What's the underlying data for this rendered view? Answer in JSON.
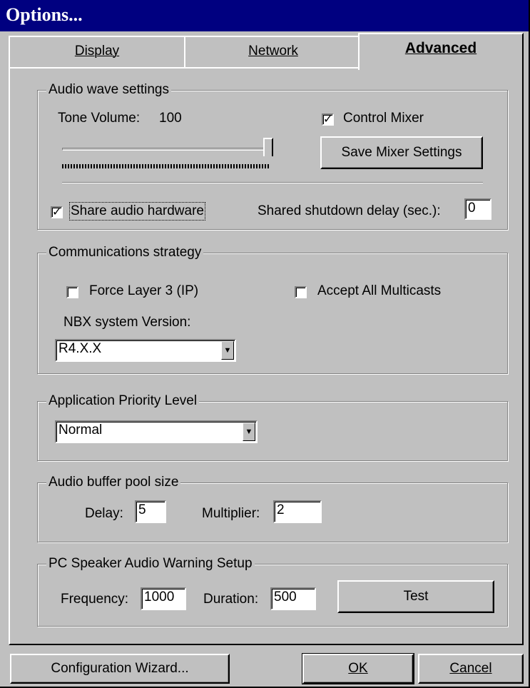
{
  "window": {
    "title": "Options..."
  },
  "tabs": [
    {
      "label": "Display",
      "active": false
    },
    {
      "label": "Network",
      "active": false
    },
    {
      "label": "Advanced",
      "active": true
    }
  ],
  "audio_wave": {
    "legend": "Audio wave settings",
    "tone_volume_label": "Tone Volume:",
    "tone_volume_value": "100",
    "tone_volume_fraction": 1.0,
    "control_mixer_label": "Control Mixer",
    "control_mixer_checked": true,
    "save_mixer_button": "Save Mixer Settings",
    "share_audio_label": "Share audio hardware",
    "share_audio_checked": true,
    "shutdown_delay_label": "Shared shutdown delay (sec.):",
    "shutdown_delay_value": "0"
  },
  "communications": {
    "legend": "Communications strategy",
    "force_layer3_label": "Force Layer 3 (IP)",
    "force_layer3_checked": false,
    "accept_multicasts_label": "Accept All Multicasts",
    "accept_multicasts_checked": false,
    "nbx_version_label": "NBX system Version:",
    "nbx_version_value": "R4.X.X"
  },
  "priority": {
    "legend": "Application Priority Level",
    "value": "Normal"
  },
  "buffer_pool": {
    "legend": "Audio buffer pool size",
    "delay_label": "Delay:",
    "delay_value": "5",
    "multiplier_label": "Multiplier:",
    "multiplier_value": "2"
  },
  "pc_speaker": {
    "legend": "PC Speaker Audio Warning Setup",
    "frequency_label": "Frequency:",
    "frequency_value": "1000",
    "duration_label": "Duration:",
    "duration_value": "500",
    "test_button": "Test"
  },
  "footer": {
    "wizard_button": "Configuration Wizard...",
    "ok_button": "OK",
    "cancel_button": "Cancel"
  },
  "colors": {
    "title_bar": "#000080",
    "face": "#c0c0c0"
  }
}
